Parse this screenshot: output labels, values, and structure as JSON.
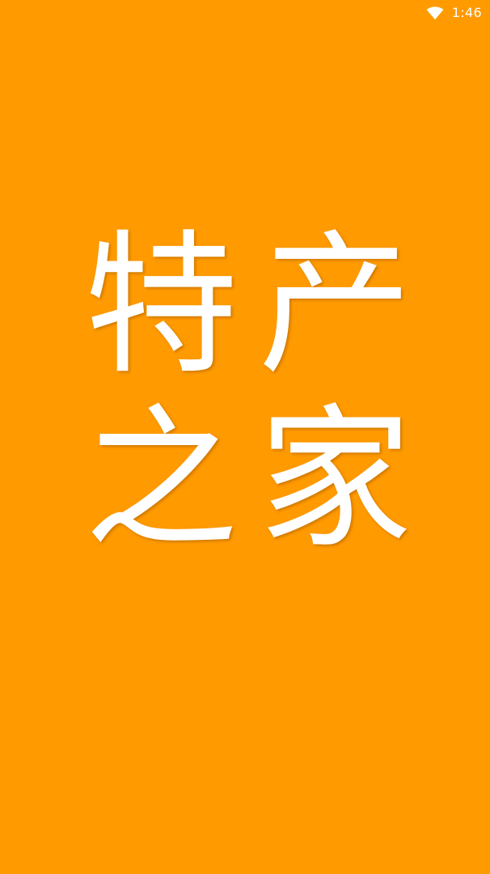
{
  "status_bar": {
    "time": "1:46",
    "icons": [
      "wifi-icon"
    ]
  },
  "splash": {
    "background_color": "#ff9a00",
    "text_color": "#ffffff",
    "logo_chars": [
      "特",
      "产",
      "之",
      "家"
    ]
  }
}
